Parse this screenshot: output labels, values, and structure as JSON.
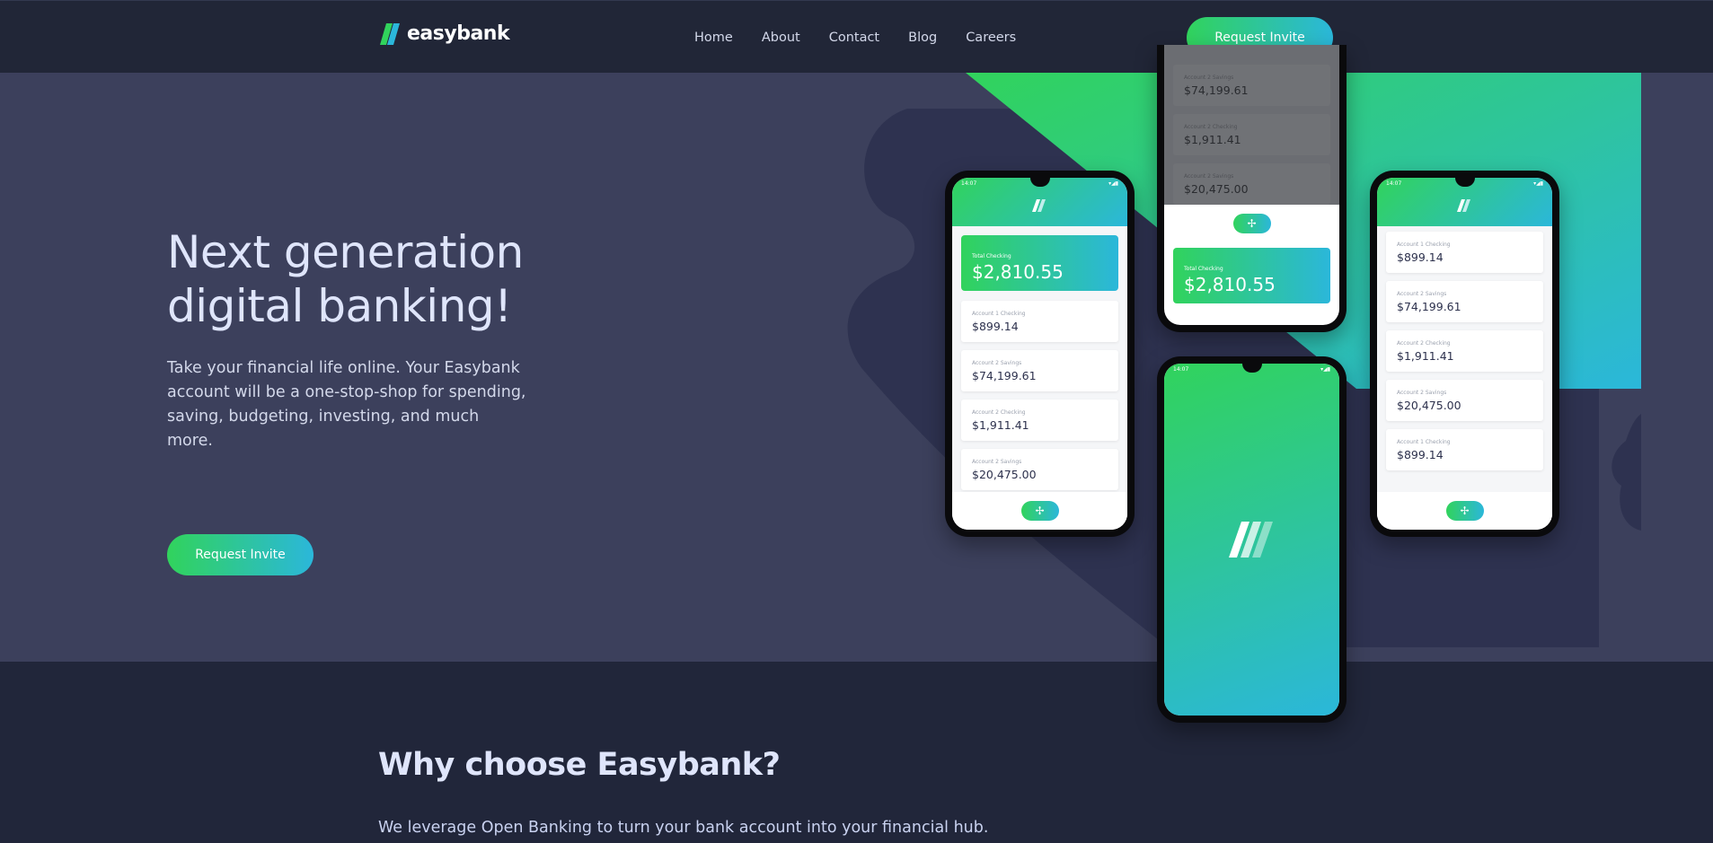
{
  "header": {
    "brand": "easybank",
    "nav": [
      "Home",
      "About",
      "Contact",
      "Blog",
      "Careers"
    ],
    "cta": "Request Invite"
  },
  "hero": {
    "title_line1": "Next generation",
    "title_line2": "digital banking!",
    "description": "Take your financial life online. Your Easybank account will be a one-stop-shop for spending, saving, budgeting, investing, and much more.",
    "cta": "Request Invite"
  },
  "mockups": {
    "time": "14:07",
    "total_label": "Total Checking",
    "total_amount": "$2,810.55",
    "left_phone": [
      {
        "label": "Account 1 Checking",
        "amount": "$899.14"
      },
      {
        "label": "Account 2 Savings",
        "amount": "$74,199.61"
      },
      {
        "label": "Account 2 Checking",
        "amount": "$1,911.41"
      },
      {
        "label": "Account 2 Savings",
        "amount": "$20,475.00"
      }
    ],
    "top_phone": [
      {
        "label": "Account 2 Savings",
        "amount": "$74,199.61"
      },
      {
        "label": "Account 2 Checking",
        "amount": "$1,911.41"
      },
      {
        "label": "Account 2 Savings",
        "amount": "$20,475.00"
      }
    ],
    "right_phone": [
      {
        "label": "Account 1 Checking",
        "amount": "$899.14"
      },
      {
        "label": "Account 2 Savings",
        "amount": "$74,199.61"
      },
      {
        "label": "Account 2 Checking",
        "amount": "$1,911.41"
      },
      {
        "label": "Account 2 Savings",
        "amount": "$20,475.00"
      },
      {
        "label": "Account 1 Checking",
        "amount": "$899.14"
      }
    ]
  },
  "why": {
    "title": "Why choose Easybank?",
    "description": "We leverage Open Banking to turn your bank account into your financial hub."
  },
  "colors": {
    "accent_green": "#31d35c",
    "accent_cyan": "#2bb7da",
    "header_bg": "#212637",
    "hero_bg": "#3c405c"
  },
  "icons": [
    "easybank-logo-icon",
    "add-icon",
    "wifi-icon",
    "battery-icon"
  ]
}
